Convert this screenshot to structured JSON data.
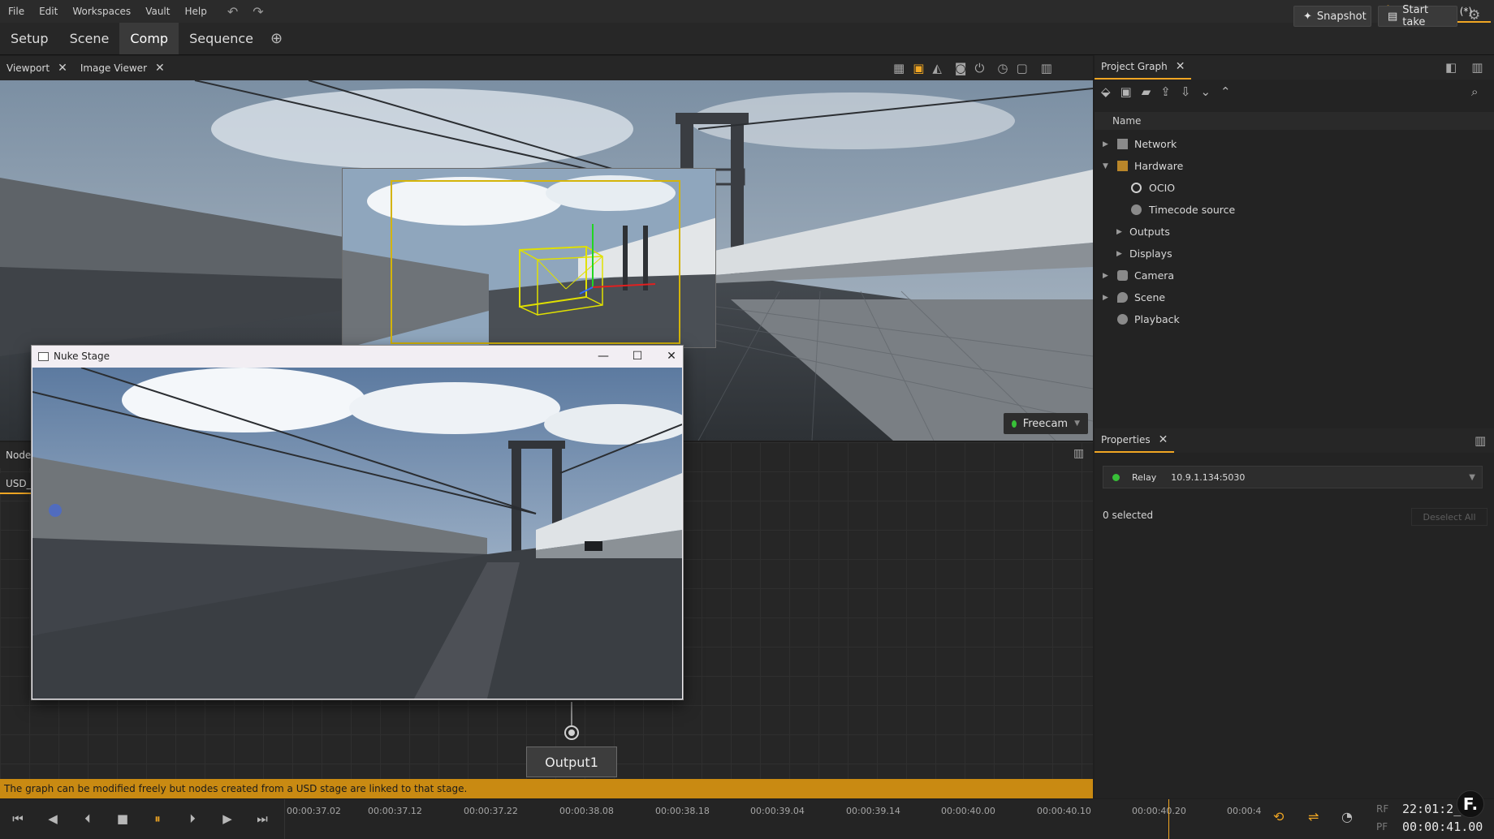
{
  "menu": [
    "File",
    "Edit",
    "Workspaces",
    "Vault",
    "Help"
  ],
  "project_title": "Project (*)",
  "workspace_tabs": [
    "Setup",
    "Scene",
    "Comp",
    "Sequence"
  ],
  "active_workspace": "Comp",
  "actions": {
    "snapshot": "Snapshot",
    "start_take": "Start take"
  },
  "viewport": {
    "tabs": [
      {
        "label": "Viewport"
      },
      {
        "label": "Image Viewer"
      }
    ],
    "camera_dropdown": "Freecam"
  },
  "floating_window": {
    "title": "Nuke Stage"
  },
  "node_graph": {
    "header": "Node",
    "tab": "USD_",
    "output_node": "Output1"
  },
  "project_graph": {
    "title": "Project Graph",
    "column": "Name",
    "tree": [
      {
        "label": "Network",
        "level": 0,
        "expanded": false,
        "has_children": true
      },
      {
        "label": "Hardware",
        "level": 0,
        "expanded": true,
        "has_children": true
      },
      {
        "label": "OCIO",
        "level": 1,
        "has_children": false
      },
      {
        "label": "Timecode source",
        "level": 1,
        "has_children": false
      },
      {
        "label": "Outputs",
        "level": 1,
        "expanded": false,
        "has_children": true
      },
      {
        "label": "Displays",
        "level": 1,
        "expanded": false,
        "has_children": true
      },
      {
        "label": "Camera",
        "level": 0,
        "expanded": false,
        "has_children": true
      },
      {
        "label": "Scene",
        "level": 0,
        "expanded": false,
        "has_children": true
      },
      {
        "label": "Playback",
        "level": 0,
        "has_children": false
      }
    ]
  },
  "properties": {
    "title": "Properties",
    "relay_label": "Relay",
    "relay_address": "10.9.1.134:5030",
    "selected_text": "0 selected",
    "deselect_all": "Deselect All"
  },
  "status_message": "The graph can be modified freely but nodes created from a USD stage are linked to that stage.",
  "timeline": {
    "ticks": [
      "00:00:37.02",
      "00:00:37.12",
      "00:00:37.22",
      "00:00:38.08",
      "00:00:38.18",
      "00:00:39.04",
      "00:00:39.14",
      "00:00:40.00",
      "00:00:40.10",
      "00:00:40.20",
      "00:00:4"
    ]
  },
  "timecode": {
    "rf_label": "RF",
    "pf_label": "PF",
    "rf_value": "22:01:2_:1",
    "pf_value": "00:00:41.00"
  },
  "brand_logo": "F.",
  "colors": {
    "accent": "#f0a623",
    "status_bar": "#c98a12",
    "live_indicator": "#38c038"
  }
}
